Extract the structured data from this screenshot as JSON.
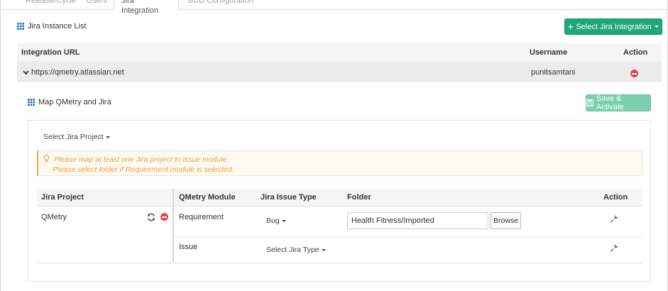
{
  "tabs": [
    {
      "label": "Release/Cycle",
      "active": false
    },
    {
      "label": "Users",
      "active": false
    },
    {
      "label": "Jira Integration",
      "active": true
    },
    {
      "label": "BDD Configuration",
      "active": false
    }
  ],
  "instance_section": {
    "title": "Jira Instance List",
    "select_button": "Select Jira Integration",
    "columns": {
      "url": "Integration URL",
      "username": "Username",
      "action": "Action"
    },
    "row": {
      "url": "https://qmetry.atlassian.net",
      "username": "punitsamtani"
    }
  },
  "map_section": {
    "title": "Map QMetry and Jira",
    "save_button": "Save & Activate",
    "select_project": "Select Jira Project",
    "alert": {
      "line1": "Please map at least one Jira project to issue module.",
      "line2": "Please select folder if Requirement module is selected."
    },
    "columns": {
      "project": "Jira Project",
      "module": "QMetry Module",
      "issue_type": "Jira Issue Type",
      "folder": "Folder",
      "action": "Action"
    },
    "project_name": "QMetry",
    "rows": [
      {
        "module": "Requirement",
        "issue_type": "Bug",
        "folder": "Health Fitness/Imported",
        "browse": "Browse"
      },
      {
        "module": "Issue",
        "issue_type": "Select Jira Type"
      }
    ]
  },
  "colors": {
    "accent_green": "#1fa67a",
    "danger_red": "#e2474b",
    "warning_orange": "#f0a04b",
    "link_blue": "#1f6fb5"
  }
}
